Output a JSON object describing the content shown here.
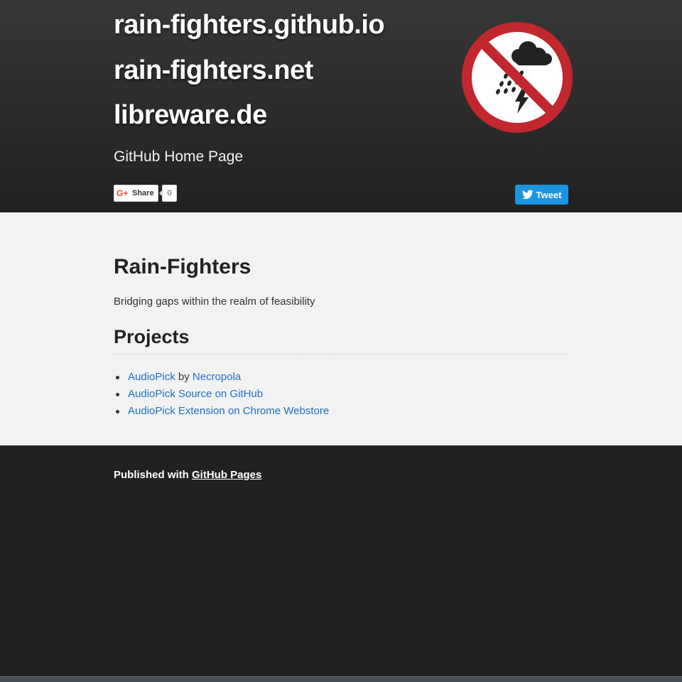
{
  "header": {
    "titles": [
      "rain-fighters.github.io",
      "rain-fighters.net",
      "libreware.de"
    ],
    "tagline": "GitHub Home Page",
    "logo": "no-rain-sign-icon",
    "share": {
      "label": "Share",
      "count": "0"
    },
    "tweet": {
      "label": "Tweet"
    }
  },
  "main": {
    "heading": "Rain-Fighters",
    "lead": "Bridging gaps within the realm of feasibility",
    "projects_heading": "Projects",
    "projects": [
      {
        "link1": "AudioPick",
        "sep": " by ",
        "link2": "Necropola"
      },
      {
        "link1": "AudioPick Source on GitHub"
      },
      {
        "link1": "AudioPick Extension on Chrome Webstore"
      }
    ]
  },
  "footer": {
    "prefix": "Published with ",
    "link": "GitHub Pages"
  },
  "colors": {
    "link": "#1f70c1",
    "header_bg": "#212121",
    "main_bg": "#f2f2f2",
    "tweet": "#1b95e0",
    "sign_red": "#c1272d"
  }
}
